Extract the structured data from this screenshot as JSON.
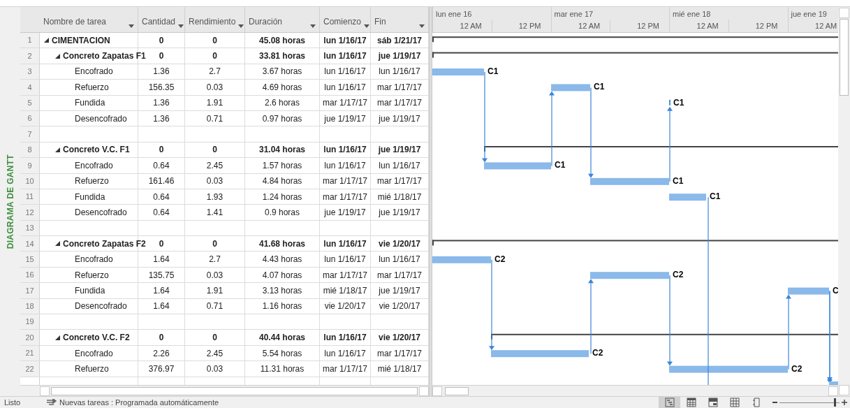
{
  "side_label": "DIAGRAMA DE GANTT",
  "table": {
    "columns": [
      "Nombre de tarea",
      "Cantidad",
      "Rendimiento",
      "Duración",
      "Comienzo",
      "Fin"
    ],
    "tasks": [
      {
        "id": "1",
        "kind": "summary",
        "expanded": true,
        "name": "CIMENTACION",
        "cantidad": "0",
        "rendimiento": "0",
        "duracion": "45.08 horas",
        "comienzo": "lun 1/16/17",
        "fin": "sáb 1/21/17",
        "children": [
          {
            "id": "2",
            "kind": "summary",
            "expanded": true,
            "name": "Concreto Zapatas F1",
            "cantidad": "0",
            "rendimiento": "0",
            "duracion": "33.81 horas",
            "comienzo": "lun 1/16/17",
            "fin": "jue 1/19/17",
            "children": [
              {
                "id": "3",
                "kind": "task",
                "name": "Encofrado",
                "cantidad": "1.36",
                "rendimiento": "2.7",
                "duracion": "3.67 horas",
                "comienzo": "lun 1/16/17",
                "fin": "lun 1/16/17",
                "bar_label": "C1"
              },
              {
                "id": "4",
                "kind": "task",
                "name": "Refuerzo",
                "cantidad": "156.35",
                "rendimiento": "0.03",
                "duracion": "4.69 horas",
                "comienzo": "lun 1/16/17",
                "fin": "mar 1/17/17",
                "bar_label": "C1"
              },
              {
                "id": "5",
                "kind": "task",
                "name": "Fundida",
                "cantidad": "1.36",
                "rendimiento": "1.91",
                "duracion": "2.6 horas",
                "comienzo": "mar 1/17/17",
                "fin": "mar 1/17/17",
                "bar_label": "C1"
              },
              {
                "id": "6",
                "kind": "task",
                "name": "Desencofrado",
                "cantidad": "1.36",
                "rendimiento": "0.71",
                "duracion": "0.97 horas",
                "comienzo": "jue 1/19/17",
                "fin": "jue 1/19/17"
              }
            ]
          },
          {
            "id": "7",
            "kind": "blank"
          },
          {
            "id": "8",
            "kind": "summary",
            "expanded": true,
            "name": "Concreto V.C. F1",
            "cantidad": "0",
            "rendimiento": "0",
            "duracion": "31.04 horas",
            "comienzo": "lun 1/16/17",
            "fin": "jue 1/19/17",
            "children": [
              {
                "id": "9",
                "kind": "task",
                "name": "Encofrado",
                "cantidad": "0.64",
                "rendimiento": "2.45",
                "duracion": "1.57 horas",
                "comienzo": "lun 1/16/17",
                "fin": "lun 1/16/17",
                "bar_label": "C1"
              },
              {
                "id": "10",
                "kind": "task",
                "name": "Refuerzo",
                "cantidad": "161.46",
                "rendimiento": "0.03",
                "duracion": "4.84 horas",
                "comienzo": "mar 1/17/17",
                "fin": "mar 1/17/17",
                "bar_label": "C1"
              },
              {
                "id": "11",
                "kind": "task",
                "name": "Fundida",
                "cantidad": "0.64",
                "rendimiento": "1.93",
                "duracion": "1.24 horas",
                "comienzo": "mar 1/17/17",
                "fin": "mié 1/18/17",
                "bar_label": "C1"
              },
              {
                "id": "12",
                "kind": "task",
                "name": "Desencofrado",
                "cantidad": "0.64",
                "rendimiento": "1.41",
                "duracion": "0.9 horas",
                "comienzo": "jue 1/19/17",
                "fin": "jue 1/19/17"
              }
            ]
          },
          {
            "id": "13",
            "kind": "blank"
          },
          {
            "id": "14",
            "kind": "summary",
            "expanded": true,
            "name": "Concreto Zapatas F2",
            "cantidad": "0",
            "rendimiento": "0",
            "duracion": "41.68 horas",
            "comienzo": "lun 1/16/17",
            "fin": "vie 1/20/17",
            "children": [
              {
                "id": "15",
                "kind": "task",
                "name": "Encofrado",
                "cantidad": "1.64",
                "rendimiento": "2.7",
                "duracion": "4.43 horas",
                "comienzo": "lun 1/16/17",
                "fin": "lun 1/16/17",
                "bar_label": "C2"
              },
              {
                "id": "16",
                "kind": "task",
                "name": "Refuerzo",
                "cantidad": "135.75",
                "rendimiento": "0.03",
                "duracion": "4.07 horas",
                "comienzo": "mar 1/17/17",
                "fin": "mar 1/17/17",
                "bar_label": "C2"
              },
              {
                "id": "17",
                "kind": "task",
                "name": "Fundida",
                "cantidad": "1.64",
                "rendimiento": "1.91",
                "duracion": "3.13 horas",
                "comienzo": "mié 1/18/17",
                "fin": "jue 1/19/17",
                "bar_label": "C"
              },
              {
                "id": "18",
                "kind": "task",
                "name": "Desencofrado",
                "cantidad": "1.64",
                "rendimiento": "0.71",
                "duracion": "1.16 horas",
                "comienzo": "vie 1/20/17",
                "fin": "vie 1/20/17"
              }
            ]
          },
          {
            "id": "19",
            "kind": "blank"
          },
          {
            "id": "20",
            "kind": "summary",
            "expanded": true,
            "name": "Concreto V.C. F2",
            "cantidad": "0",
            "rendimiento": "0",
            "duracion": "40.44 horas",
            "comienzo": "lun 1/16/17",
            "fin": "vie 1/20/17",
            "children": [
              {
                "id": "21",
                "kind": "task",
                "name": "Encofrado",
                "cantidad": "2.26",
                "rendimiento": "2.45",
                "duracion": "5.54 horas",
                "comienzo": "lun 1/16/17",
                "fin": "mar 1/17/17",
                "bar_label": "C2"
              },
              {
                "id": "22",
                "kind": "task",
                "name": "Refuerzo",
                "cantidad": "376.97",
                "rendimiento": "0.03",
                "duracion": "11.31 horas",
                "comienzo": "mar 1/17/17",
                "fin": "mié 1/18/17",
                "bar_label": "C2"
              }
            ]
          }
        ]
      }
    ]
  },
  "timescale": {
    "days": [
      "lun ene 16",
      "mar ene 17",
      "mié ene 18",
      "jue ene 19"
    ],
    "hours": [
      "12 AM",
      "12 PM",
      "12 AM",
      "12 PM",
      "12 AM",
      "12 PM",
      "12 AM"
    ]
  },
  "status_bar": {
    "ready": "Listo",
    "new_tasks": "Nuevas tareas : Programada automáticamente",
    "views": [
      {
        "kind": "gantt",
        "selected": true
      },
      {
        "kind": "calendar",
        "selected": false
      },
      {
        "kind": "team",
        "selected": false
      },
      {
        "kind": "sheet",
        "selected": false
      },
      {
        "kind": "report",
        "selected": false
      }
    ],
    "zoom": {
      "level": 0.92
    }
  }
}
